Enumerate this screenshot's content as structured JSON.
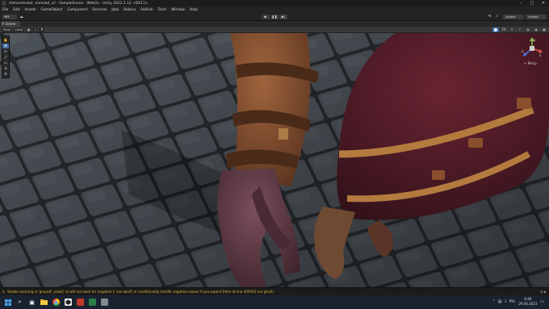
{
  "window": {
    "title": "Administrator: eimolad_v2 - SampleScene - WebGL - Unity 2022.2.12 <DX11>",
    "controls": [
      "–",
      "□",
      "✕"
    ]
  },
  "menu": [
    "File",
    "Edit",
    "Assets",
    "GameObject",
    "Component",
    "Services",
    "Jobs",
    "Bakery",
    "Publish",
    "Tools",
    "Window",
    "Help"
  ],
  "toolbar": {
    "account_label": "MM",
    "play_icons": [
      "▶",
      "❚❚",
      "▶|"
    ],
    "layers_label": "Layers",
    "layout_label": "Layout"
  },
  "scene_tab": {
    "label": "Scene",
    "more": "⋮"
  },
  "scene_toolbar": {
    "pivot_label": "Pivot",
    "space_label": "Local",
    "snap_label": "1",
    "grid_label": "",
    "right_icons": [
      "⬤",
      "2D",
      "☀",
      "♪",
      "▤",
      "◉",
      "▦"
    ]
  },
  "gizmo": {
    "label": "< Persp",
    "axes": [
      "x",
      "y",
      "z"
    ]
  },
  "colors": {
    "accent": "#3d6bb5",
    "warning": "#e2b93b",
    "leather_brown": "#7a4a2e",
    "cloth_red": "#5a1e28",
    "stone": "#5b6066"
  },
  "status": {
    "warning_text": "Shader warning in 'ground': pow(f, e) will not work for negative f, use abs(f) or conditionally handle negative values if you expect them at line 305913 (on gles3)"
  },
  "taskbar": {
    "icons": [
      "windows-start-icon",
      "search-icon",
      "task-view-icon",
      "file-explorer-icon",
      "chrome-icon",
      "unity-icon",
      "app-icon",
      "terminal-icon",
      "notes-icon"
    ],
    "language": "РУС",
    "time": "0:46",
    "date": "29.06.2023"
  }
}
